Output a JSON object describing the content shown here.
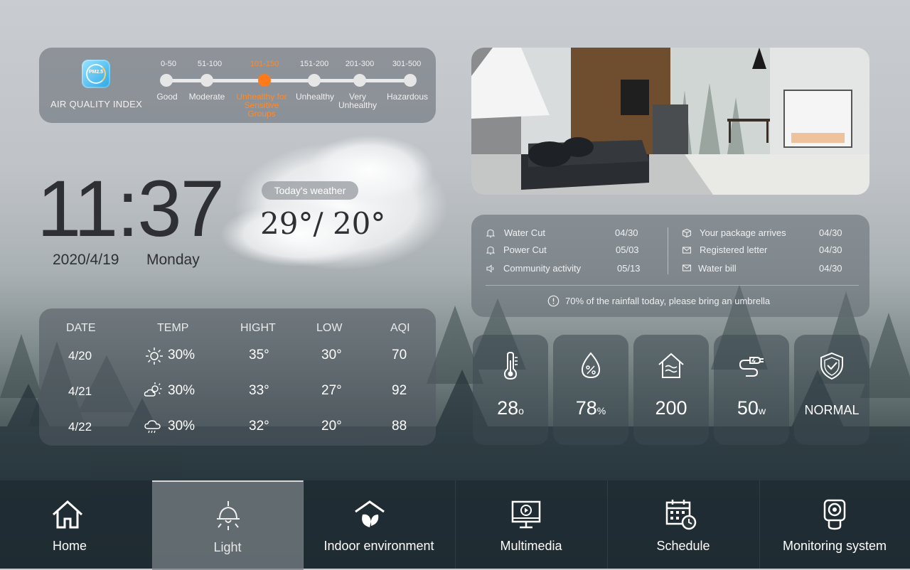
{
  "aqi": {
    "title": "AIR QUALITY INDEX",
    "logo_text": "PM2.5",
    "levels": [
      {
        "range": "0-50",
        "label": "Good",
        "active": false
      },
      {
        "range": "51-100",
        "label": "Moderate",
        "active": false
      },
      {
        "range": "101-150",
        "label": "Unhealthy for Sensitive Groups",
        "active": true
      },
      {
        "range": "151-200",
        "label": "Unhealthy",
        "active": false
      },
      {
        "range": "201-300",
        "label": "Very Unhealthy",
        "active": false
      },
      {
        "range": "301-500",
        "label": "Hazardous",
        "active": false
      }
    ],
    "active_color": "#ff7a1a"
  },
  "clock": {
    "time": "11:37",
    "date": "2020/4/19",
    "weekday": "Monday"
  },
  "today_weather": {
    "badge": "Today's weather",
    "temp": "29°/ 20°"
  },
  "forecast": {
    "headers": [
      "DATE",
      "TEMP",
      "HIGHT",
      "LOW",
      "AQI"
    ],
    "rows": [
      {
        "date": "4/20",
        "icon": "sun-icon",
        "temp": "30%",
        "high": "35°",
        "low": "30°",
        "aqi": "70"
      },
      {
        "date": "4/21",
        "icon": "partly-cloudy-icon",
        "temp": "30%",
        "high": "33°",
        "low": "27°",
        "aqi": "92"
      },
      {
        "date": "4/22",
        "icon": "rain-icon",
        "temp": "30%",
        "high": "32°",
        "low": "20°",
        "aqi": "88"
      }
    ]
  },
  "notices": {
    "left": [
      {
        "icon": "bell-icon",
        "label": "Water Cut",
        "date": "04/30"
      },
      {
        "icon": "bell-icon",
        "label": "Power Cut",
        "date": "05/03"
      },
      {
        "icon": "speaker-icon",
        "label": "Community activity",
        "date": "05/13"
      }
    ],
    "right": [
      {
        "icon": "package-icon",
        "label": "Your package arrives",
        "date": "04/30"
      },
      {
        "icon": "mail-icon",
        "label": "Registered letter",
        "date": "04/30"
      },
      {
        "icon": "mail-icon",
        "label": "Water bill",
        "date": "04/30"
      }
    ],
    "tip": "70% of the rainfall today, please bring an umbrella"
  },
  "sensors": [
    {
      "icon": "thermometer-icon",
      "value": "28",
      "unit": "o"
    },
    {
      "icon": "humidity-icon",
      "value": "78",
      "unit": "%"
    },
    {
      "icon": "air-house-icon",
      "value": "200",
      "unit": ""
    },
    {
      "icon": "power-plug-icon",
      "value": "50",
      "unit": "w"
    },
    {
      "icon": "security-shield-icon",
      "value": "NORMAL",
      "unit": ""
    }
  ],
  "nav": {
    "items": [
      {
        "label": "Home",
        "icon": "home-icon",
        "active": false
      },
      {
        "label": "Light",
        "icon": "lamp-icon",
        "active": true
      },
      {
        "label": "Indoor environment",
        "icon": "leaf-house-icon",
        "active": false
      },
      {
        "label": "Multimedia",
        "icon": "monitor-play-icon",
        "active": false
      },
      {
        "label": "Schedule",
        "icon": "calendar-clock-icon",
        "active": false
      },
      {
        "label": "Monitoring system",
        "icon": "camera-icon",
        "active": false
      }
    ]
  }
}
